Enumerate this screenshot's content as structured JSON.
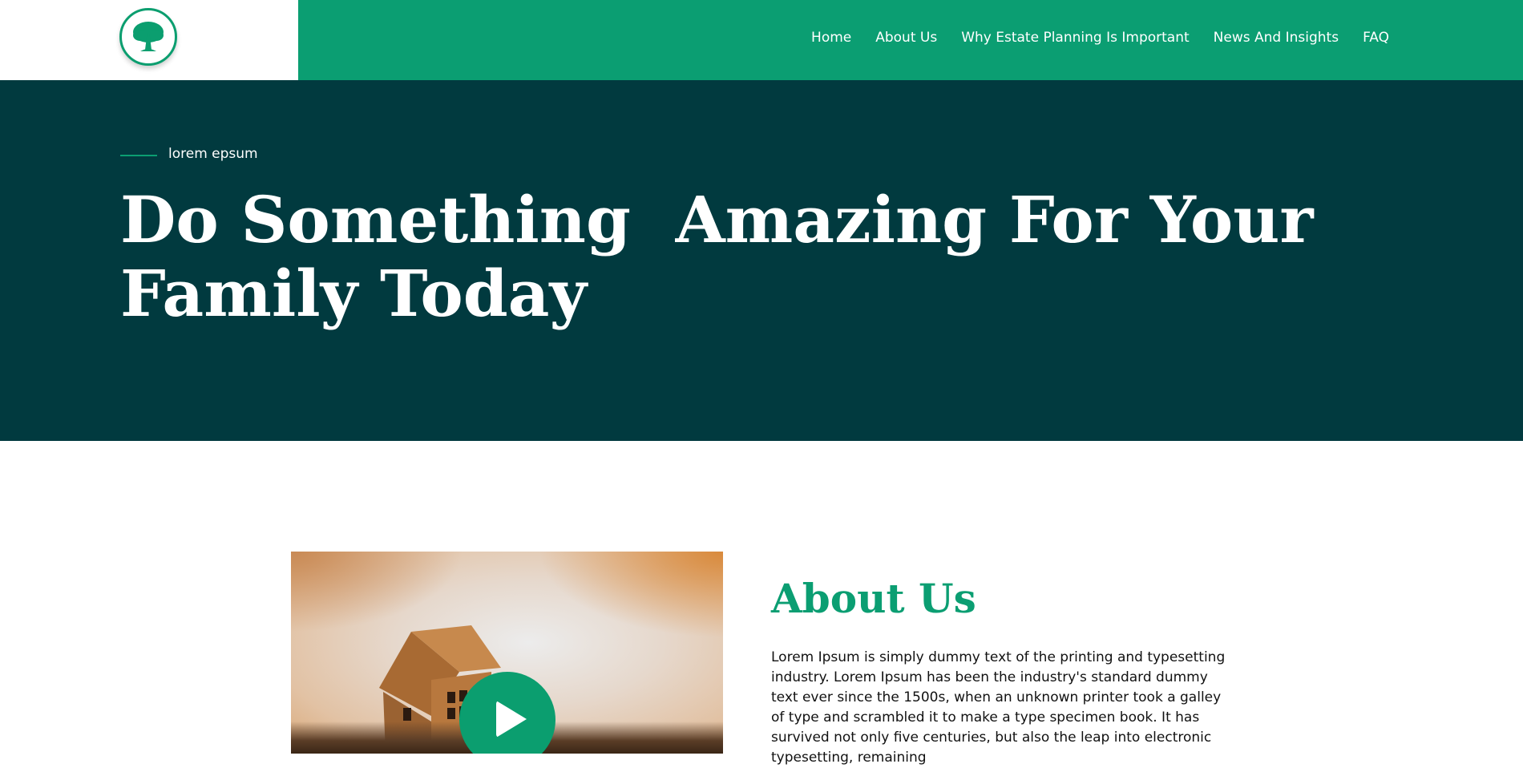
{
  "header": {
    "logo": "tree-logo",
    "nav": [
      "Home",
      "About Us",
      "Why Estate Planning Is Important",
      "News And Insights",
      "FAQ"
    ]
  },
  "hero": {
    "eyebrow": "lorem epsum",
    "title": "Do Something  Amazing For Your Family Today"
  },
  "about": {
    "title": "About Us",
    "text": "Lorem Ipsum is simply dummy text of the printing and typesetting industry. Lorem Ipsum has been the industry's standard dummy text ever since the 1500s, when an unknown printer took a galley of type and scrambled it to make a type specimen book. It has survived not only five centuries, but also the leap into electronic typesetting, remaining"
  },
  "colors": {
    "brand_green": "#0b9e72",
    "hero_bg": "#013a3f",
    "white": "#ffffff"
  }
}
